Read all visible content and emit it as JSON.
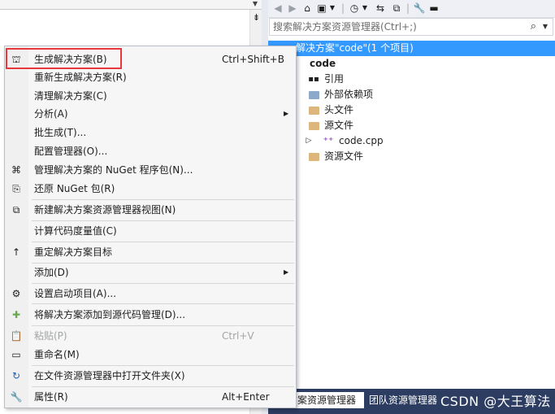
{
  "editor": {
    "split_icon": "split-icon",
    "dropdown_icon": "chevron-down-icon"
  },
  "toolbar": {
    "icons": [
      "back-icon",
      "forward-icon",
      "home-icon",
      "vs-solution-icon",
      "dropdown-icon",
      "history-icon",
      "sync-icon",
      "collapse-icon",
      "wrench-icon",
      "pin-icon"
    ]
  },
  "search": {
    "placeholder": "搜索解决方案资源管理器(Ctrl+;)"
  },
  "tree": {
    "solution": "解决方案\"code\"(1 个项目)",
    "project": "code",
    "items": [
      {
        "label": "引用"
      },
      {
        "label": "外部依赖项"
      },
      {
        "label": "头文件"
      },
      {
        "label": "源文件"
      },
      {
        "label": "code.cpp"
      },
      {
        "label": "资源文件"
      }
    ]
  },
  "bottom_tabs": {
    "active": "方案资源管理器",
    "other": "团队资源管理器"
  },
  "watermark": "CSDN @大王算法",
  "menu": {
    "items": [
      {
        "label": "生成解决方案(B)",
        "shortcut": "Ctrl+Shift+B",
        "icon": "build-icon"
      },
      {
        "label": "重新生成解决方案(R)",
        "shortcut": ""
      },
      {
        "label": "清理解决方案(C)",
        "shortcut": ""
      },
      {
        "label": "分析(A)",
        "shortcut": "",
        "submenu": true
      },
      {
        "label": "批生成(T)...",
        "shortcut": ""
      },
      {
        "label": "配置管理器(O)...",
        "shortcut": ""
      },
      {
        "label": "管理解决方案的 NuGet 程序包(N)...",
        "shortcut": "",
        "icon": "nuget-icon"
      },
      {
        "label": "还原 NuGet 包(R)",
        "shortcut": "",
        "icon": "restore-icon"
      },
      {
        "label": "新建解决方案资源管理器视图(N)",
        "shortcut": "",
        "icon": "new-view-icon"
      },
      {
        "label": "计算代码度量值(C)",
        "shortcut": ""
      },
      {
        "label": "重定解决方案目标",
        "shortcut": "",
        "icon": "retarget-icon"
      },
      {
        "label": "添加(D)",
        "shortcut": "",
        "submenu": true
      },
      {
        "label": "设置启动项目(A)...",
        "shortcut": "",
        "icon": "gear-icon"
      },
      {
        "label": "将解决方案添加到源代码管理(D)...",
        "shortcut": "",
        "icon": "source-control-icon"
      },
      {
        "label": "粘贴(P)",
        "shortcut": "Ctrl+V",
        "icon": "paste-icon",
        "disabled": true
      },
      {
        "label": "重命名(M)",
        "shortcut": "",
        "icon": "rename-icon"
      },
      {
        "label": "在文件资源管理器中打开文件夹(X)",
        "shortcut": "",
        "icon": "open-folder-icon"
      },
      {
        "label": "属性(R)",
        "shortcut": "Alt+Enter",
        "icon": "wrench-icon"
      }
    ]
  },
  "colors": {
    "selection": "#3399ff",
    "highlight_box": "#e8383d",
    "tab_bar": "#2c3d61"
  }
}
